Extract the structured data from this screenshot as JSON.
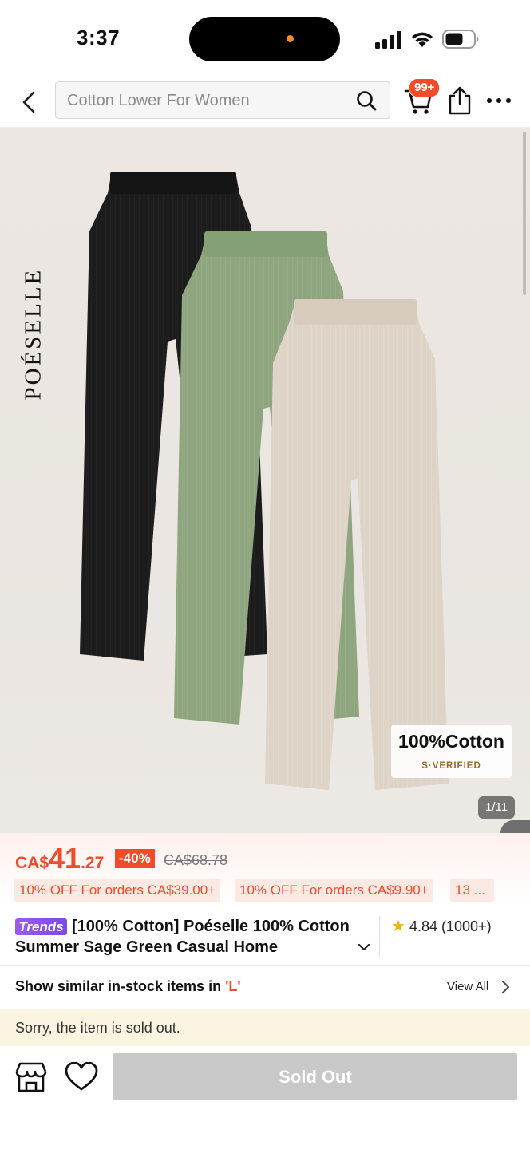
{
  "status_bar": {
    "time": "3:37"
  },
  "nav": {
    "search_placeholder": "Cotton Lower For Women",
    "cart_badge": "99+"
  },
  "gallery": {
    "brand_logo": "POÉSELLE",
    "badge_title": "100%Cotton",
    "badge_subtitle": "S·VERIFIED",
    "counter": "1/11",
    "pants_colors": [
      "#1b1b1b",
      "#8ea57f",
      "#ddd3c6"
    ]
  },
  "side_tab": {
    "glyph": "❬"
  },
  "pricing": {
    "currency": "CA$",
    "price_int": "41",
    "price_dec": ".27",
    "discount": "-40%",
    "original_price": "CA$68.78",
    "accent_color": "#f24b2a"
  },
  "coupons": [
    "10% OFF For orders CA$39.00+",
    "10% OFF For orders CA$9.90+",
    "13 ..."
  ],
  "product": {
    "trends_label": "Trends",
    "title": "[100% Cotton] Poéselle 100% Cotton Summer Sage Green Casual Home",
    "rating": "4.84",
    "review_count": "(1000+)"
  },
  "similar": {
    "text": "Show similar in-stock items in ",
    "size": "'L'",
    "view_all": "View All"
  },
  "notice": {
    "sold_out_text": "Sorry, the item is sold out."
  },
  "bottom_bar": {
    "sold_out_label": "Sold Out"
  }
}
